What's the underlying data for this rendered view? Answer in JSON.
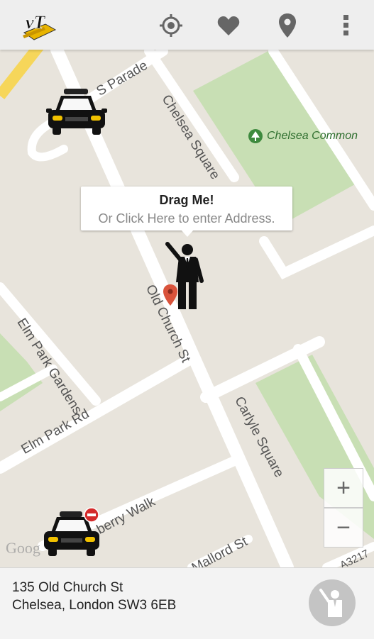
{
  "app": {
    "logo_text": "vT"
  },
  "toolbar": {
    "icons": [
      "locate-icon",
      "favorites-icon",
      "place-pin-icon",
      "overflow-menu-icon"
    ]
  },
  "map": {
    "streets": {
      "s_parade": "S Parade",
      "chelsea_square": "Chelsea Square",
      "old_church_st": "Old Church St",
      "elm_park_gardens": "Elm Park Gardens",
      "elm_park_rd": "Elm Park Rd",
      "carlyle_square": "Carlyle Square",
      "mulberry_walk": "berry Walk",
      "mallord_st": "Mallord St",
      "a3217": "A3217"
    },
    "park_name": "Chelsea Common",
    "callout": {
      "title": "Drag Me!",
      "subtitle": "Or Click Here to enter Address."
    },
    "zoom_in": "+",
    "zoom_out": "−",
    "attribution": "Goog"
  },
  "address": {
    "line1": "135 Old Church St",
    "line2": "Chelsea, London SW3 6EB"
  },
  "colors": {
    "map_bg": "#e8e4dc",
    "park": "#c8dfb4",
    "road": "#ffffff",
    "highway": "#f6d65a",
    "taxi_yellow": "#f2c200",
    "pin_red": "#d9533b"
  }
}
